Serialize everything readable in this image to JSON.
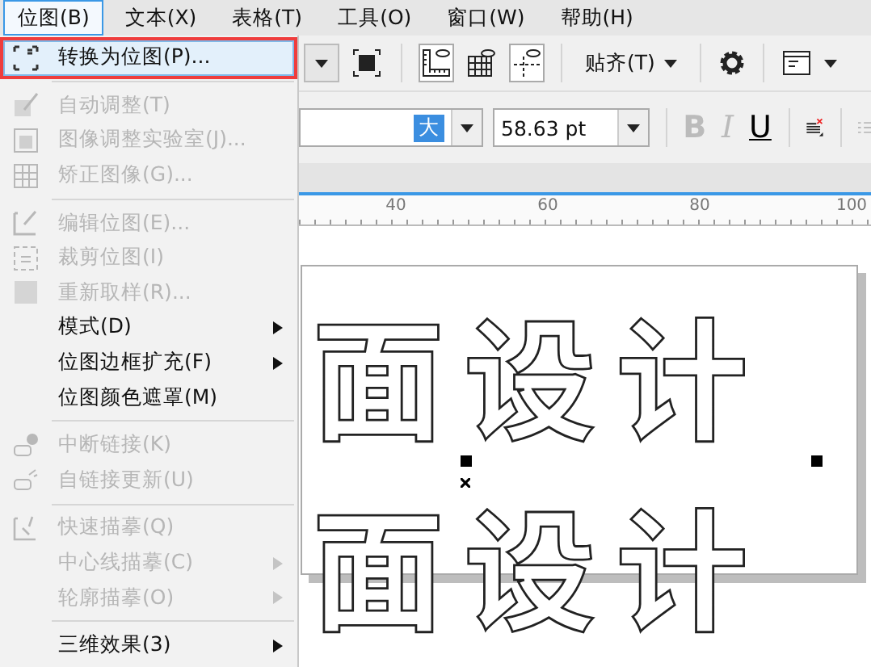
{
  "menubar": [
    {
      "label": "位图(B)",
      "selected": true
    },
    {
      "label": "文本(X)",
      "selected": false
    },
    {
      "label": "表格(T)",
      "selected": false
    },
    {
      "label": "工具(O)",
      "selected": false
    },
    {
      "label": "窗口(W)",
      "selected": false
    },
    {
      "label": "帮助(H)",
      "selected": false
    }
  ],
  "menu": {
    "items": [
      {
        "kind": "item",
        "label": "转换为位图(P)...",
        "disabled": false,
        "selected": true,
        "submenu": false,
        "callout": true
      },
      {
        "kind": "separator"
      },
      {
        "kind": "item",
        "label": "自动调整(T)",
        "disabled": true,
        "selected": false,
        "submenu": false,
        "callout": false
      },
      {
        "kind": "item",
        "label": "图像调整实验室(J)...",
        "disabled": true,
        "selected": false,
        "submenu": false,
        "callout": false
      },
      {
        "kind": "item",
        "label": "矫正图像(G)...",
        "disabled": true,
        "selected": false,
        "submenu": false,
        "callout": false
      },
      {
        "kind": "separator"
      },
      {
        "kind": "item",
        "label": "编辑位图(E)...",
        "disabled": true,
        "selected": false,
        "submenu": false,
        "callout": false
      },
      {
        "kind": "item",
        "label": "裁剪位图(I)",
        "disabled": true,
        "selected": false,
        "submenu": false,
        "callout": false
      },
      {
        "kind": "item",
        "label": "重新取样(R)...",
        "disabled": true,
        "selected": false,
        "submenu": false,
        "callout": false
      },
      {
        "kind": "item",
        "label": "模式(D)",
        "disabled": false,
        "selected": false,
        "submenu": true,
        "callout": false
      },
      {
        "kind": "item",
        "label": "位图边框扩充(F)",
        "disabled": false,
        "selected": false,
        "submenu": true,
        "callout": false
      },
      {
        "kind": "item",
        "label": "位图颜色遮罩(M)",
        "disabled": false,
        "selected": false,
        "submenu": false,
        "callout": false
      },
      {
        "kind": "separator"
      },
      {
        "kind": "item",
        "label": "中断链接(K)",
        "disabled": true,
        "selected": false,
        "submenu": false,
        "callout": false
      },
      {
        "kind": "item",
        "label": "自链接更新(U)",
        "disabled": true,
        "selected": false,
        "submenu": false,
        "callout": false
      },
      {
        "kind": "separator"
      },
      {
        "kind": "item",
        "label": "快速描摹(Q)",
        "disabled": true,
        "selected": false,
        "submenu": false,
        "callout": false
      },
      {
        "kind": "item",
        "label": "中心线描摹(C)",
        "disabled": true,
        "selected": false,
        "submenu": true,
        "callout": false
      },
      {
        "kind": "item",
        "label": "轮廓描摹(O)",
        "disabled": true,
        "selected": false,
        "submenu": true,
        "callout": false
      },
      {
        "kind": "separator"
      },
      {
        "kind": "item",
        "label": "三维效果(3)",
        "disabled": false,
        "selected": false,
        "submenu": true,
        "callout": false
      }
    ]
  },
  "toolbar": {
    "ruler_on": true,
    "grid_on": false,
    "guides_on": true,
    "snap_label": "贴齐(T)"
  },
  "text_bar": {
    "font_name": "大",
    "font_size": "58.63 pt",
    "style_buttons": [
      {
        "kind": "bold",
        "label": "B",
        "disabled": true
      },
      {
        "kind": "italic",
        "label": "I",
        "disabled": true
      },
      {
        "kind": "underline",
        "label": "U",
        "disabled": false
      }
    ]
  },
  "ruler": {
    "ticks": [
      "40",
      "60",
      "80",
      "100"
    ]
  },
  "canvas": {
    "text_lines": [
      "面设计",
      "面设计"
    ]
  }
}
